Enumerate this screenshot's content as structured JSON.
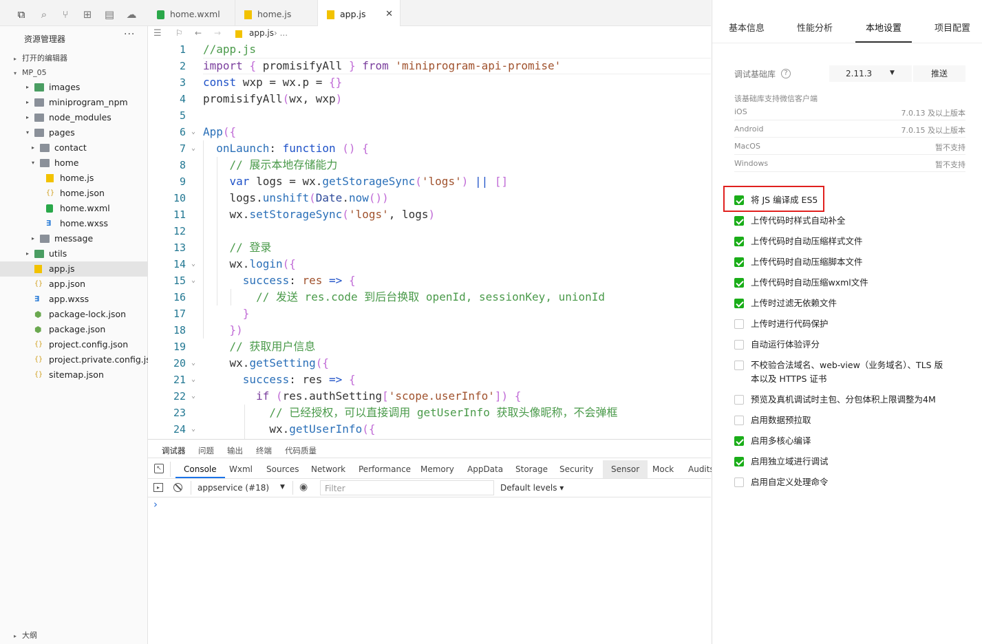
{
  "activity_bar": {
    "icons": [
      "files-icon",
      "search-icon",
      "source-control-icon",
      "extensions-icon",
      "debug-icon",
      "cloud-icon"
    ]
  },
  "explorer": {
    "title": "资源管理器",
    "more": "···",
    "open_editors": "打开的编辑器",
    "project": "MP_05",
    "tree": [
      {
        "label": "images",
        "type": "folder-green",
        "depth": 1,
        "arrow": "▸"
      },
      {
        "label": "miniprogram_npm",
        "type": "folder",
        "depth": 1,
        "arrow": "▸"
      },
      {
        "label": "node_modules",
        "type": "folder",
        "depth": 1,
        "arrow": "▸"
      },
      {
        "label": "pages",
        "type": "folder",
        "depth": 1,
        "arrow": "▾"
      },
      {
        "label": "contact",
        "type": "folder",
        "depth": 2,
        "arrow": "▸"
      },
      {
        "label": "home",
        "type": "folder",
        "depth": 2,
        "arrow": "▾"
      },
      {
        "label": "home.js",
        "type": "js",
        "depth": 3,
        "arrow": ""
      },
      {
        "label": "home.json",
        "type": "json",
        "depth": 3,
        "arrow": ""
      },
      {
        "label": "home.wxml",
        "type": "wxml",
        "depth": 3,
        "arrow": ""
      },
      {
        "label": "home.wxss",
        "type": "wxss",
        "depth": 3,
        "arrow": ""
      },
      {
        "label": "message",
        "type": "folder",
        "depth": 2,
        "arrow": "▸"
      },
      {
        "label": "utils",
        "type": "folder-green",
        "depth": 1,
        "arrow": "▸"
      },
      {
        "label": "app.js",
        "type": "js",
        "depth": 1,
        "arrow": "",
        "selected": true
      },
      {
        "label": "app.json",
        "type": "json",
        "depth": 1,
        "arrow": ""
      },
      {
        "label": "app.wxss",
        "type": "wxss",
        "depth": 1,
        "arrow": ""
      },
      {
        "label": "package-lock.json",
        "type": "pkg",
        "depth": 1,
        "arrow": ""
      },
      {
        "label": "package.json",
        "type": "pkg",
        "depth": 1,
        "arrow": ""
      },
      {
        "label": "project.config.json",
        "type": "json",
        "depth": 1,
        "arrow": ""
      },
      {
        "label": "project.private.config.js...",
        "type": "json",
        "depth": 1,
        "arrow": ""
      },
      {
        "label": "sitemap.json",
        "type": "json",
        "depth": 1,
        "arrow": ""
      }
    ],
    "outline": "大纲"
  },
  "tabs": [
    {
      "label": "home.wxml",
      "icon": "wxml",
      "active": false
    },
    {
      "label": "home.js",
      "icon": "js",
      "active": false
    },
    {
      "label": "app.js",
      "icon": "js",
      "active": true,
      "close": "✕"
    }
  ],
  "breadcrumb": {
    "file": "app.js",
    "rest": "›  ..."
  },
  "code_lines": [
    [
      [
        "cm",
        "//app.js"
      ]
    ],
    [
      [
        "kw",
        "import"
      ],
      [
        "pl",
        " "
      ],
      [
        "pu",
        "{"
      ],
      [
        "pl",
        " promisifyAll "
      ],
      [
        "pu",
        "}"
      ],
      [
        "pl",
        " "
      ],
      [
        "kw",
        "from"
      ],
      [
        "pl",
        " "
      ],
      [
        "str",
        "'miniprogram-api-promise'"
      ]
    ],
    [
      [
        "kb",
        "const"
      ],
      [
        "pl",
        " wxp = wx.p = "
      ],
      [
        "pu",
        "{}"
      ]
    ],
    [
      [
        "pl",
        "promisifyAll"
      ],
      [
        "pu",
        "("
      ],
      [
        "pl",
        "wx, wxp"
      ],
      [
        "pu",
        ")"
      ]
    ],
    [
      [
        "pl",
        ""
      ]
    ],
    [
      [
        "fn",
        "App"
      ],
      [
        "pu",
        "({"
      ]
    ],
    [
      [
        "pl",
        "  "
      ],
      [
        "fn",
        "onLaunch"
      ],
      [
        "pl",
        ": "
      ],
      [
        "kb",
        "function"
      ],
      [
        "pl",
        " "
      ],
      [
        "pu",
        "()"
      ],
      [
        "pl",
        " "
      ],
      [
        "pu",
        "{"
      ]
    ],
    [
      [
        "pl",
        "    "
      ],
      [
        "cm",
        "// 展示本地存储能力"
      ]
    ],
    [
      [
        "pl",
        "    "
      ],
      [
        "kb",
        "var"
      ],
      [
        "pl",
        " logs = wx."
      ],
      [
        "fn",
        "getStorageSync"
      ],
      [
        "pu",
        "("
      ],
      [
        "str",
        "'logs'"
      ],
      [
        "pu",
        ")"
      ],
      [
        "pl",
        " "
      ],
      [
        "kb",
        "||"
      ],
      [
        "pl",
        " "
      ],
      [
        "pu",
        "[]"
      ]
    ],
    [
      [
        "pl",
        "    logs."
      ],
      [
        "fn",
        "unshift"
      ],
      [
        "pu",
        "("
      ],
      [
        "nm",
        "Date"
      ],
      [
        "pl",
        "."
      ],
      [
        "fn",
        "now"
      ],
      [
        "pu",
        "())"
      ]
    ],
    [
      [
        "pl",
        "    wx."
      ],
      [
        "fn",
        "setStorageSync"
      ],
      [
        "pu",
        "("
      ],
      [
        "str",
        "'logs'"
      ],
      [
        "pl",
        ", logs"
      ],
      [
        "pu",
        ")"
      ]
    ],
    [
      [
        "pl",
        ""
      ]
    ],
    [
      [
        "pl",
        "    "
      ],
      [
        "cm",
        "// 登录"
      ]
    ],
    [
      [
        "pl",
        "    wx."
      ],
      [
        "fn",
        "login"
      ],
      [
        "pu",
        "({"
      ]
    ],
    [
      [
        "pl",
        "      "
      ],
      [
        "fn",
        "success"
      ],
      [
        "pl",
        ": "
      ],
      [
        "str",
        "res"
      ],
      [
        "pl",
        " "
      ],
      [
        "kb",
        "=>"
      ],
      [
        "pl",
        " "
      ],
      [
        "pu",
        "{"
      ]
    ],
    [
      [
        "pl",
        "        "
      ],
      [
        "cm",
        "// 发送 res.code 到后台换取 openId, sessionKey, unionId"
      ]
    ],
    [
      [
        "pl",
        "      "
      ],
      [
        "pu",
        "}"
      ]
    ],
    [
      [
        "pl",
        "    "
      ],
      [
        "pu",
        "})"
      ]
    ],
    [
      [
        "pl",
        "    "
      ],
      [
        "cm",
        "// 获取用户信息"
      ]
    ],
    [
      [
        "pl",
        "    wx."
      ],
      [
        "fn",
        "getSetting"
      ],
      [
        "pu",
        "({"
      ]
    ],
    [
      [
        "pl",
        "      "
      ],
      [
        "fn",
        "success"
      ],
      [
        "pl",
        ": res "
      ],
      [
        "kb",
        "=>"
      ],
      [
        "pl",
        " "
      ],
      [
        "pu",
        "{"
      ]
    ],
    [
      [
        "pl",
        "        "
      ],
      [
        "kw",
        "if"
      ],
      [
        "pl",
        " "
      ],
      [
        "pu",
        "("
      ],
      [
        "pl",
        "res.authSetting"
      ],
      [
        "pu",
        "["
      ],
      [
        "str",
        "'scope.userInfo'"
      ],
      [
        "pu",
        "])"
      ],
      [
        "pl",
        " "
      ],
      [
        "pu",
        "{"
      ]
    ],
    [
      [
        "pl",
        "          "
      ],
      [
        "cm",
        "// 已经授权，可以直接调用 getUserInfo 获取头像昵称，不会弹框"
      ]
    ],
    [
      [
        "pl",
        "          wx."
      ],
      [
        "fn",
        "getUserInfo"
      ],
      [
        "pu",
        "({"
      ]
    ]
  ],
  "fold_markers": [
    6,
    7,
    14,
    15,
    20,
    21,
    22,
    24
  ],
  "panel": {
    "tabs": [
      "调试器",
      "问题",
      "输出",
      "终端",
      "代码质量"
    ],
    "devtools_tabs": [
      "Console",
      "Wxml",
      "Sources",
      "Network",
      "Performance",
      "Memory",
      "AppData",
      "Storage",
      "Security",
      "Sensor",
      "Mock",
      "Audits"
    ],
    "context": "appservice (#18)",
    "filter_placeholder": "Filter",
    "levels": "Default levels ▾",
    "prompt": "›"
  },
  "settings": {
    "tabs": [
      "基本信息",
      "性能分析",
      "本地设置",
      "项目配置"
    ],
    "active_tab": "本地设置",
    "lib_label": "调试基础库",
    "lib_version": "2.11.3",
    "push_label": "推送",
    "support_title": "该基础库支持微信客户端",
    "support": [
      {
        "os": "iOS",
        "ver": "7.0.13 及以上版本"
      },
      {
        "os": "Android",
        "ver": "7.0.15 及以上版本"
      },
      {
        "os": "MacOS",
        "ver": "暂不支持"
      },
      {
        "os": "Windows",
        "ver": "暂不支持"
      }
    ],
    "options": [
      {
        "label": "将 JS 编译成 ES5",
        "checked": true
      },
      {
        "label": "上传代码时样式自动补全",
        "checked": true
      },
      {
        "label": "上传代码时自动压缩样式文件",
        "checked": true
      },
      {
        "label": "上传代码时自动压缩脚本文件",
        "checked": true
      },
      {
        "label": "上传代码时自动压缩wxml文件",
        "checked": true
      },
      {
        "label": "上传时过滤无依赖文件",
        "checked": true
      },
      {
        "label": "上传时进行代码保护",
        "checked": false
      },
      {
        "label": "自动运行体验评分",
        "checked": false
      },
      {
        "label": "不校验合法域名、web-view（业务域名）、TLS 版",
        "label2": "本以及 HTTPS 证书",
        "checked": false
      },
      {
        "label": "预览及真机调试时主包、分包体积上限调整为4M",
        "checked": false
      },
      {
        "label": "启用数据预拉取",
        "checked": false
      },
      {
        "label": "启用多核心编译",
        "checked": true
      },
      {
        "label": "启用独立域进行调试",
        "checked": true
      },
      {
        "label": "启用自定义处理命令",
        "checked": false
      }
    ],
    "highlight_color": "#e0201e",
    "check_color": "#1aad19"
  }
}
